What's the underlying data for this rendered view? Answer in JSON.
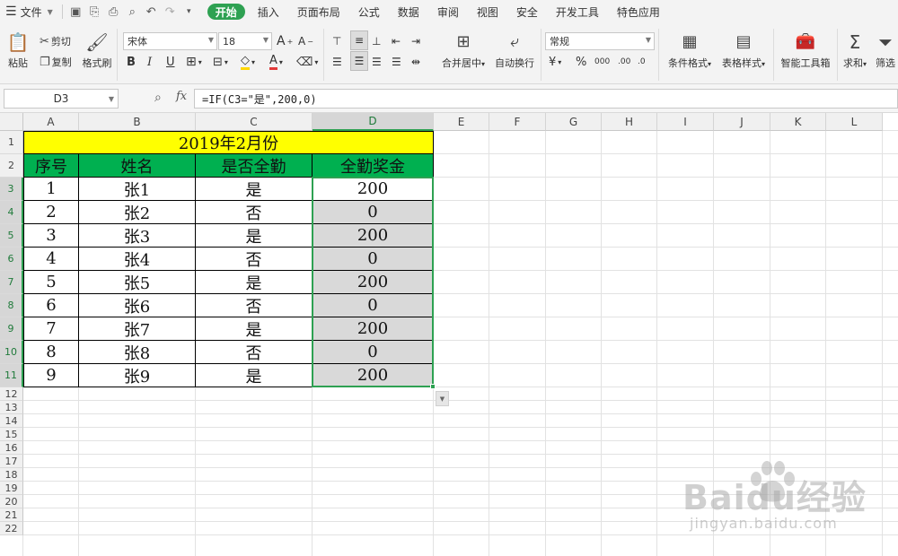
{
  "menubar": {
    "file_label": "文件",
    "tabs": [
      "开始",
      "插入",
      "页面布局",
      "公式",
      "数据",
      "审阅",
      "视图",
      "安全",
      "开发工具",
      "特色应用"
    ],
    "active_tab": "开始"
  },
  "ribbon": {
    "paste_label": "粘贴",
    "cut_label": "剪切",
    "copy_label": "复制",
    "format_painter_label": "格式刷",
    "font_name": "宋体",
    "font_size": "18",
    "merge_center_label": "合并居中",
    "wrap_text_label": "自动换行",
    "number_format": "常规",
    "conditional_format_label": "条件格式",
    "table_style_label": "表格样式",
    "smart_toolbox_label": "智能工具箱",
    "sum_label": "求和",
    "filter_label": "筛选"
  },
  "formula_bar": {
    "name_box": "D3",
    "fx": "fx",
    "formula": "=IF(C3=\"是\",200,0)"
  },
  "sheet": {
    "columns": [
      "A",
      "B",
      "C",
      "D",
      "E",
      "F",
      "G",
      "H",
      "I",
      "J",
      "K",
      "L"
    ],
    "rows": [
      "1",
      "2",
      "3",
      "4",
      "5",
      "6",
      "7",
      "8",
      "9",
      "10",
      "11",
      "12",
      "13",
      "14",
      "15",
      "16",
      "17",
      "18",
      "19",
      "20",
      "21",
      "22"
    ],
    "selected_column": "D",
    "title": "2019年2月份",
    "headers": [
      "序号",
      "姓名",
      "是否全勤",
      "全勤奖金"
    ],
    "records": [
      [
        "1",
        "张1",
        "是",
        "200"
      ],
      [
        "2",
        "张2",
        "否",
        "0"
      ],
      [
        "3",
        "张3",
        "是",
        "200"
      ],
      [
        "4",
        "张4",
        "否",
        "0"
      ],
      [
        "5",
        "张5",
        "是",
        "200"
      ],
      [
        "6",
        "张6",
        "否",
        "0"
      ],
      [
        "7",
        "张7",
        "是",
        "200"
      ],
      [
        "8",
        "张8",
        "否",
        "0"
      ],
      [
        "9",
        "张9",
        "是",
        "200"
      ]
    ]
  },
  "watermark": {
    "brand": "Baidu经验",
    "url": "jingyan.baidu.com"
  },
  "colors": {
    "accent": "#2ea152",
    "title_fill": "#ffff00",
    "header_fill": "#00b050",
    "selection_fill": "#d9d9d9"
  }
}
